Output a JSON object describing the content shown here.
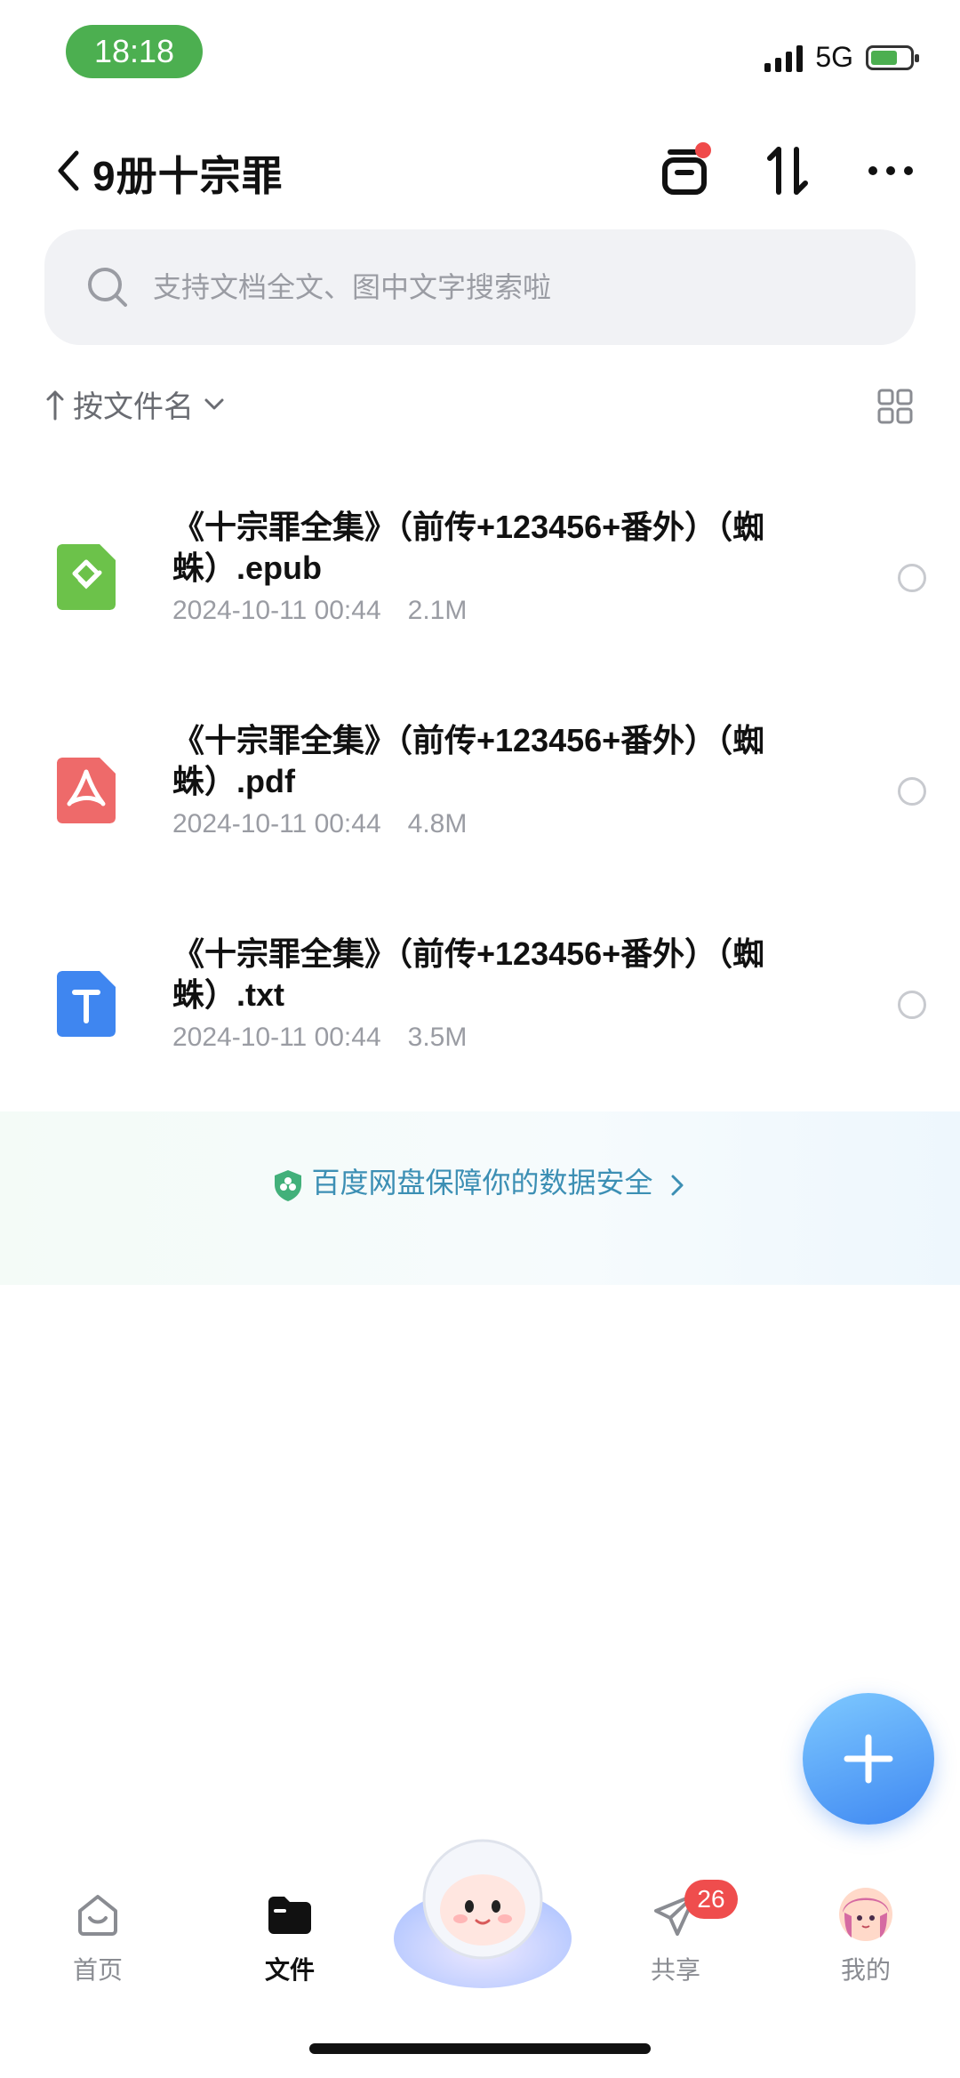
{
  "status": {
    "time": "18:18",
    "network": "5G"
  },
  "header": {
    "title": "9册十宗罪"
  },
  "search": {
    "placeholder": "支持文档全文、图中文字搜索啦"
  },
  "sort": {
    "label": "按文件名"
  },
  "files": [
    {
      "name": "《十宗罪全集》（前传+123456+番外）（蜘蛛）.epub",
      "date": "2024-10-11 00:44",
      "size": "2.1M",
      "type": "epub",
      "color": "#6cc24a"
    },
    {
      "name": "《十宗罪全集》（前传+123456+番外）（蜘蛛）.pdf",
      "date": "2024-10-11 00:44",
      "size": "4.8M",
      "type": "pdf",
      "color": "#ee6a6a"
    },
    {
      "name": "《十宗罪全集》（前传+123456+番外）（蜘蛛）.txt",
      "date": "2024-10-11 00:44",
      "size": "3.5M",
      "type": "txt",
      "color": "#3f86f0"
    }
  ],
  "safety": {
    "text": "百度网盘保障你的数据安全"
  },
  "nav": {
    "home": "首页",
    "files": "文件",
    "share": "共享",
    "share_badge": "26",
    "me": "我的"
  }
}
